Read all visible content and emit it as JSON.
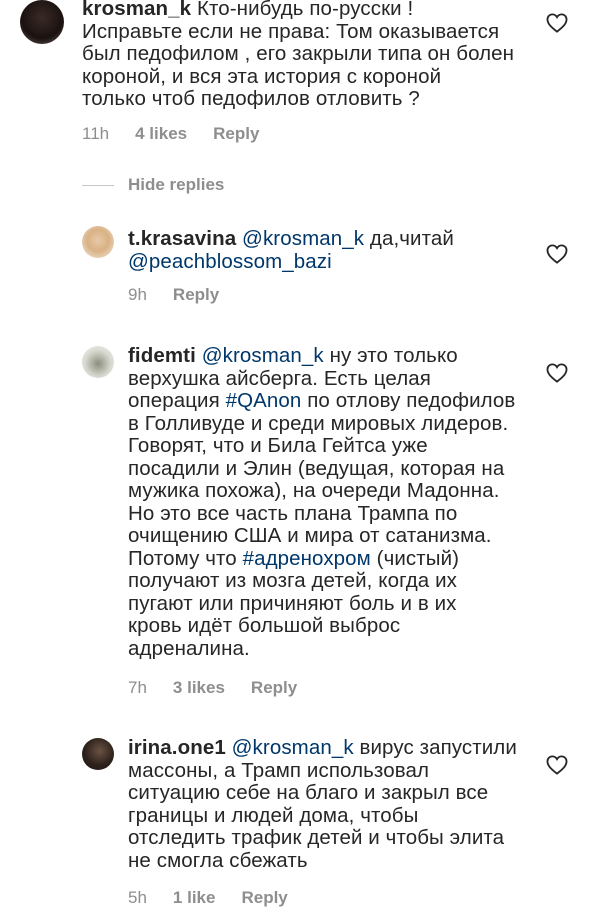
{
  "comments": [
    {
      "username": "krosman_k",
      "text_lines": [
        "Кто-нибудь по-русски !",
        "Исправьте если не права: Том оказывается",
        "был педофилом , его закрыли типа он болен",
        "короной, и вся эта история с короной",
        "только чтоб педофилов отловить ?"
      ],
      "time": "11h",
      "likes": "4 likes",
      "reply": "Reply"
    },
    {
      "username": "t.krasavina",
      "mention": "@krosman_k",
      "first_line_rest": " да,читай",
      "text_lines": [
        "@peachblossom_bazi"
      ],
      "time": "9h",
      "reply": "Reply"
    },
    {
      "username": "fidemti",
      "mention": "@krosman_k",
      "first_line_rest": " ну это только",
      "text_lines": [
        "верхушка айсберга. Есть целая",
        "операция ",
        "в Голливуде и среди мировых лидеров.",
        "Говорят, что и Била Гейтса уже",
        "посадили и Элин (ведущая, которая на",
        "мужика похожа), на очереди Мадонна.",
        "Но это все часть плана Трампа по",
        "очищению США и мира от сатанизма.",
        "Потому что ",
        "получают из мозга детей, когда их",
        "пугают или причиняют боль и в их",
        "кровь идёт большой выброс",
        "адреналина."
      ],
      "hashtag1": "#QAnon",
      "after_hashtag1": " по отлову педофилов",
      "hashtag2": "#адренохром",
      "after_hashtag2": " (чистый)",
      "time": "7h",
      "likes": "3 likes",
      "reply": "Reply"
    },
    {
      "username": "irina.one1",
      "mention": "@krosman_k",
      "first_line_rest": " вирус запустили",
      "text_lines": [
        "массоны, а Трамп использовал",
        "ситуацию себе на благо и закрыл все",
        "границы и людей дома, чтобы",
        "отследить трафик детей и чтобы элита",
        "не смогла сбежать"
      ],
      "time": "5h",
      "likes": "1 like",
      "reply": "Reply"
    }
  ],
  "hide_replies": "Hide replies",
  "colors": {
    "mention": "#00376b",
    "meta": "#8e8e8e",
    "text": "#262626"
  }
}
